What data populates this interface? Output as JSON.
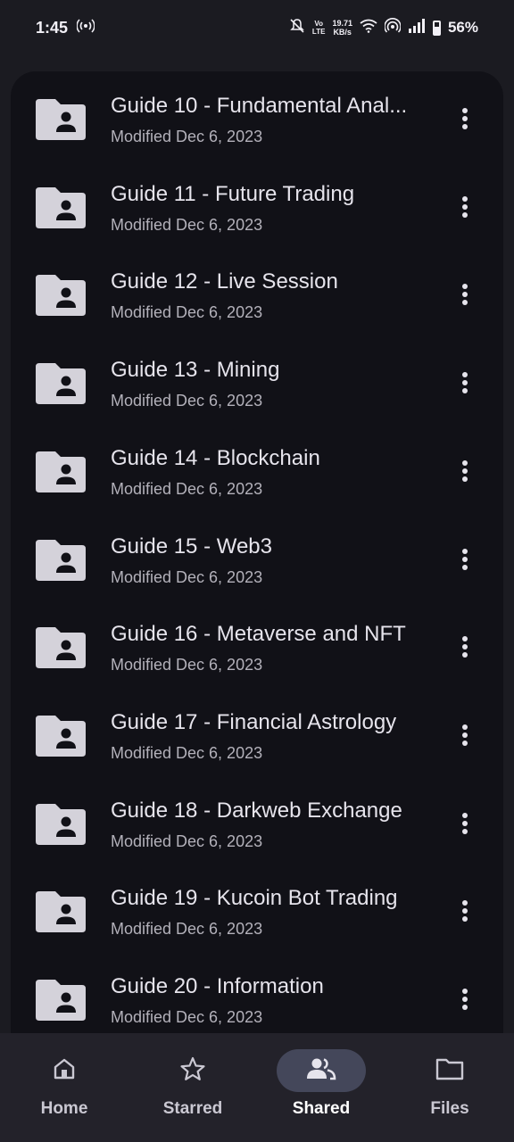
{
  "status_bar": {
    "time": "1:45",
    "volte_top": "Vo",
    "volte_bottom": "LTE",
    "speed_value": "19.71",
    "speed_unit": "KB/s",
    "battery": "56%"
  },
  "files": [
    {
      "title": "Guide 10 - Fundamental Anal...",
      "modified": "Modified Dec 6, 2023"
    },
    {
      "title": "Guide 11 - Future Trading",
      "modified": "Modified Dec 6, 2023"
    },
    {
      "title": "Guide 12 - Live Session",
      "modified": "Modified Dec 6, 2023"
    },
    {
      "title": "Guide 13 - Mining",
      "modified": "Modified Dec 6, 2023"
    },
    {
      "title": "Guide 14 - Blockchain",
      "modified": "Modified Dec 6, 2023"
    },
    {
      "title": "Guide 15 - Web3",
      "modified": "Modified Dec 6, 2023"
    },
    {
      "title": "Guide 16 - Metaverse and NFT",
      "modified": "Modified Dec 6, 2023"
    },
    {
      "title": "Guide 17 - Financial Astrology",
      "modified": "Modified Dec 6, 2023"
    },
    {
      "title": "Guide 18 - Darkweb Exchange",
      "modified": "Modified Dec 6, 2023"
    },
    {
      "title": "Guide 19 - Kucoin Bot Trading",
      "modified": "Modified Dec 6, 2023"
    },
    {
      "title": "Guide 20 - Information",
      "modified": "Modified Dec 6, 2023"
    }
  ],
  "nav": {
    "home": "Home",
    "starred": "Starred",
    "shared": "Shared",
    "files": "Files",
    "active": "shared"
  },
  "colors": {
    "background": "#1b1b21",
    "list_background": "#111117",
    "nav_background": "#23222a",
    "active_pill": "#44475a"
  }
}
